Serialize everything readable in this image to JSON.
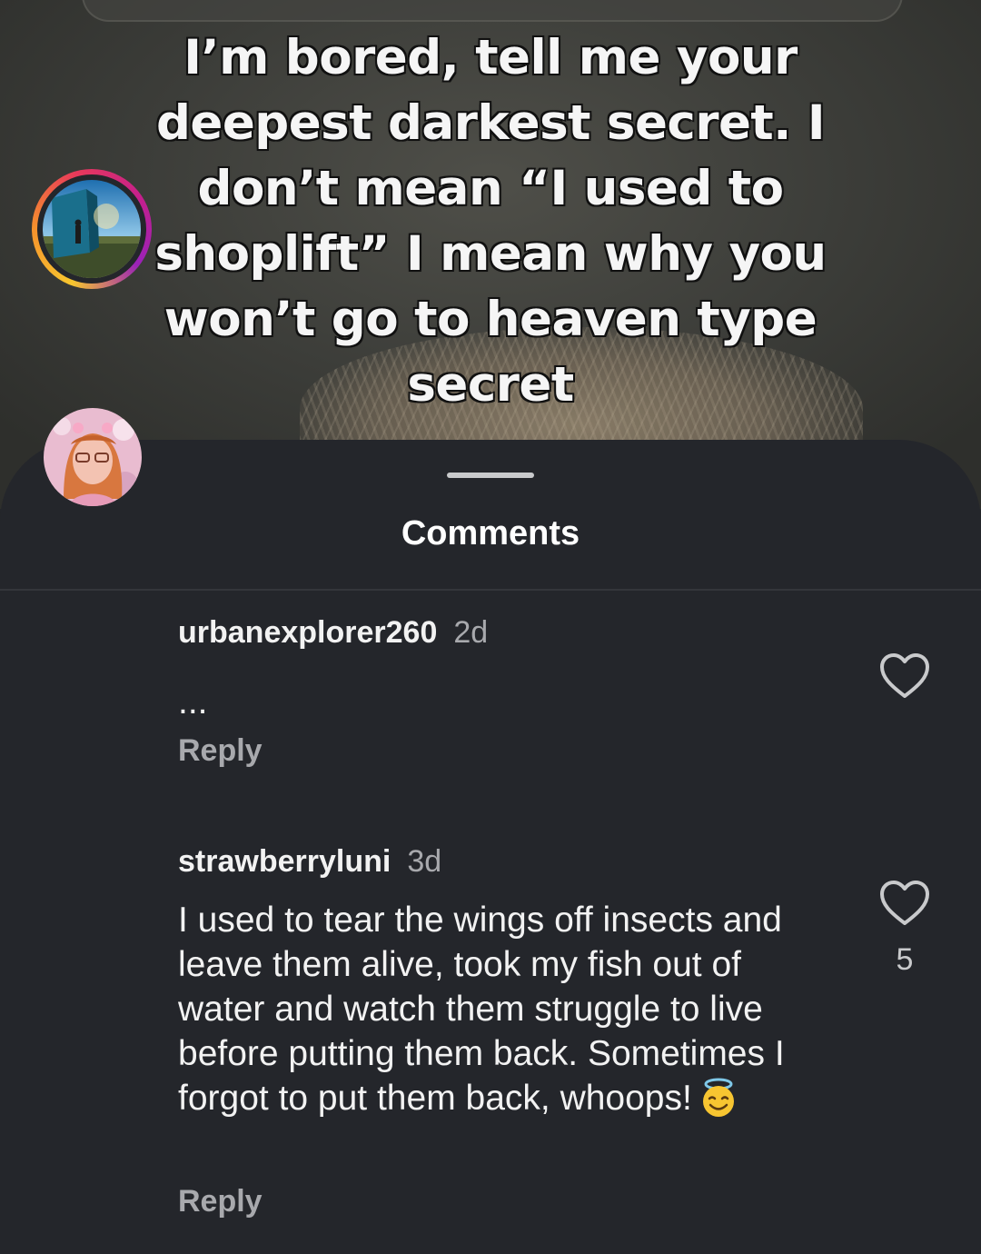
{
  "video": {
    "overlay_text": "I’m bored, tell me your deepest darkest secret. I don’t mean “I used to shoplift” I mean why you won’t go to heaven type secret"
  },
  "sheet": {
    "title": "Comments"
  },
  "comments": [
    {
      "username": "urbanexplorer260",
      "time": "2d",
      "text": "...",
      "reply_label": "Reply",
      "like_count": "",
      "avatar_icon": "avatar-photo-with-story-ring"
    },
    {
      "username": "strawberryluni",
      "time": "3d",
      "text": "I used to tear the wings off insects and leave them alive, took my fish out of water and watch them struggle to live before putting them back. Sometimes I forgot to put them back, whoops!",
      "emoji": "smiling-face-with-halo-icon",
      "reply_label": "Reply",
      "like_count": "5",
      "avatar_icon": "avatar-photo"
    }
  ],
  "colors": {
    "sheet_background": "#24262b",
    "text_primary": "#f2f2f2",
    "text_secondary": "#a8a9ad",
    "story_ring": [
      "#f7c62e",
      "#f5902d",
      "#e8395a",
      "#c51f8c",
      "#9a22b8"
    ]
  }
}
